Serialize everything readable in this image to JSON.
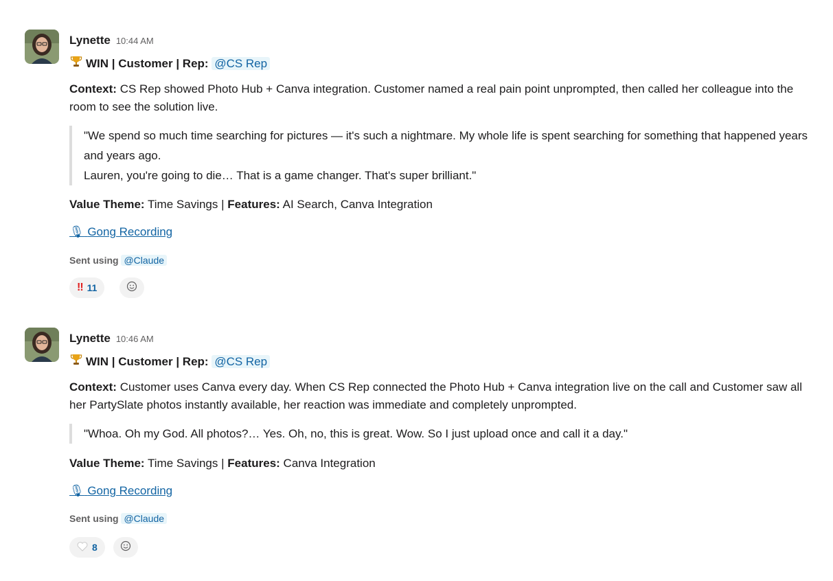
{
  "messages": [
    {
      "author": "Lynette",
      "time": "10:44 AM",
      "headline": {
        "icon": "trophy-icon",
        "emoji": "🏆",
        "text": "WIN | Customer | Rep:",
        "mention": "@CS Rep"
      },
      "context_label": "Context:",
      "context_text": "CS Rep showed Photo Hub + Canva integration. Customer named a real pain point unprompted, then called her colleague into the room to see the solution live.",
      "quote_lines": [
        "\"We spend so much time searching for pictures — it's such a nightmare. My whole life is spent searching for something that happened years and years ago.",
        "Lauren, you're going to die… That is a game changer. That's super brilliant.\""
      ],
      "value_theme_label": "Value Theme:",
      "value_theme": "Time Savings",
      "separator": "|",
      "features_label": "Features:",
      "features": "AI Search, Canva Integration",
      "link_icon": "microphone-icon",
      "link_text": "Gong Recording",
      "sent_using_label": "Sent using",
      "sent_using_mention": "@Claude",
      "reactions": [
        {
          "icon": "double-exclamation-icon",
          "emoji": "!!",
          "count": "11"
        }
      ]
    },
    {
      "author": "Lynette",
      "time": "10:46 AM",
      "headline": {
        "icon": "trophy-icon",
        "emoji": "🏆",
        "text": "WIN | Customer | Rep:",
        "mention": "@CS Rep"
      },
      "context_label": "Context:",
      "context_text": "Customer uses Canva every day. When CS Rep connected the Photo Hub + Canva integration live on the call and Customer saw all her PartySlate photos instantly available, her reaction was immediate and completely unprompted.",
      "quote_lines": [
        "\"Whoa. Oh my God. All photos?… Yes. Oh, no, this is great. Wow. So I just upload once and call it a day.\""
      ],
      "value_theme_label": "Value Theme:",
      "value_theme": "Time Savings",
      "separator": "|",
      "features_label": "Features:",
      "features": "Canva Integration",
      "link_icon": "microphone-icon",
      "link_text": "Gong Recording",
      "sent_using_label": "Sent using",
      "sent_using_mention": "@Claude",
      "reactions": [
        {
          "icon": "white-heart-icon",
          "emoji": "🤍",
          "count": "8"
        }
      ]
    }
  ]
}
